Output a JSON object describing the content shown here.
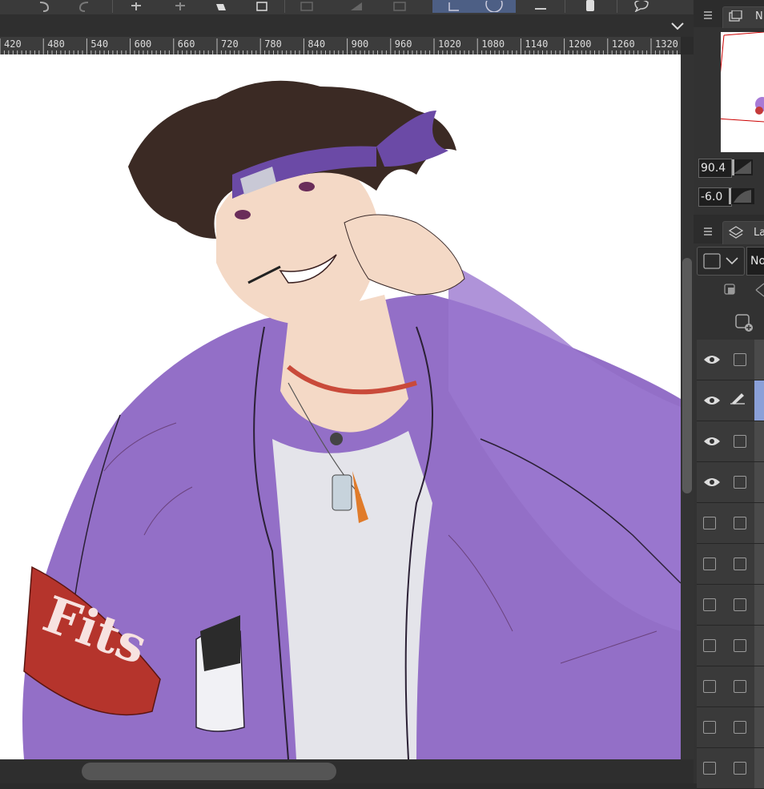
{
  "ruler": {
    "labels": [
      "420",
      "480",
      "540",
      "600",
      "660",
      "720",
      "780",
      "840",
      "900",
      "960",
      "1020",
      "1080",
      "1140",
      "1200",
      "1260",
      "1320"
    ]
  },
  "navigator": {
    "zoom_value": "90.4",
    "rotate_value": "-6.0",
    "tab_label": "N"
  },
  "layers": {
    "tab_label": "La",
    "blend_mode": "No"
  },
  "artwork": {
    "armband_text": "Fits"
  },
  "colors": {
    "accent": "#4d5f85",
    "jacket": "#8a63c2",
    "armband": "#b5342c",
    "hair": "#3b2a24",
    "skin": "#f4d9c6",
    "shirt": "#e4e4ea"
  }
}
